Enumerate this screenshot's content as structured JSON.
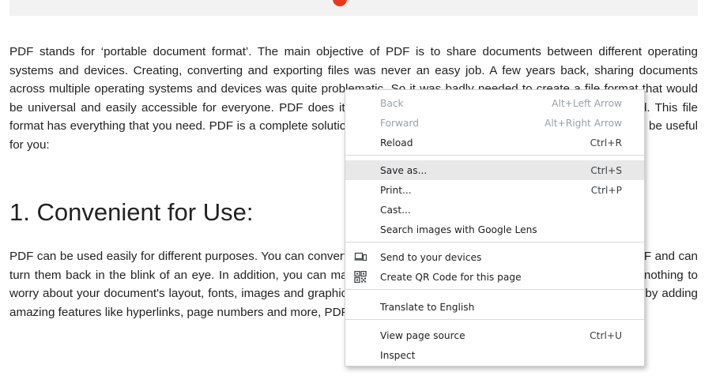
{
  "article": {
    "para1": "PDF stands for ‘portable document format’. The main objective of PDF is to share documents between different operating systems and devices. Creating, converting and exporting files was never an easy job. A few years back, sharing documents across multiple operating systems and devices was quite problematic. So it was badly needed to create a file format that would be universal and easily accessible for everyone. PDF does it. It is a widely used document format across the world. This file format has everything that you need. PDF is a complete solution for your all PDF needs. Here are some ways PDF can be useful for you:",
    "heading1": "1. Convenient for Use:",
    "para2": "PDF can be used easily for different purposes. You can convert your files such as Word, Excel and PowerPoint into PDF and can turn them back in the blink of an eye. In addition, you can make PDF attractive with its functional features. There is nothing to worry about your document's layout, fonts, images and graphics in any case. If you want to make your work attractive by adding amazing features like hyperlinks, page numbers and more, PDF format can do it for you."
  },
  "context_menu": {
    "back": {
      "label": "Back",
      "shortcut": "Alt+Left Arrow"
    },
    "forward": {
      "label": "Forward",
      "shortcut": "Alt+Right Arrow"
    },
    "reload": {
      "label": "Reload",
      "shortcut": "Ctrl+R"
    },
    "save_as": {
      "label": "Save as...",
      "shortcut": "Ctrl+S"
    },
    "print": {
      "label": "Print...",
      "shortcut": "Ctrl+P"
    },
    "cast": {
      "label": "Cast..."
    },
    "search_lens": {
      "label": "Search images with Google Lens"
    },
    "send_devices": {
      "label": "Send to your devices",
      "icon": "devices-icon"
    },
    "qr_code": {
      "label": "Create QR Code for this page",
      "icon": "qr-code-icon"
    },
    "translate": {
      "label": "Translate to English"
    },
    "view_source": {
      "label": "View page source",
      "shortcut": "Ctrl+U"
    },
    "inspect": {
      "label": "Inspect"
    }
  },
  "colors": {
    "accent_dot": "#e8391d",
    "hover_bg": "#e8e8e9",
    "disabled_text": "#9aa0a6"
  }
}
